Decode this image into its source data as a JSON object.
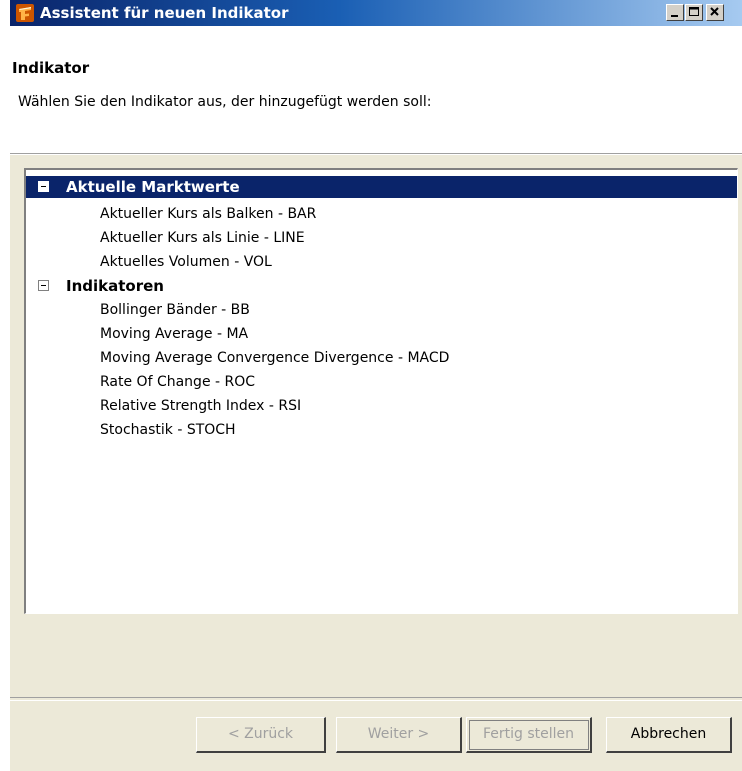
{
  "window": {
    "title": "Assistent für neuen Indikator"
  },
  "header": {
    "title": "Indikator",
    "description": "Wählen Sie den Indikator aus, der hinzugefügt werden soll:"
  },
  "tree": {
    "groups": [
      {
        "label": "Aktuelle Marktwerte",
        "selected": true,
        "items": [
          "Aktueller Kurs als Balken - BAR",
          "Aktueller Kurs als Linie - LINE",
          "Aktuelles Volumen - VOL"
        ]
      },
      {
        "label": "Indikatoren",
        "selected": false,
        "items": [
          "Bollinger Bänder - BB",
          "Moving Average - MA",
          "Moving Average Convergence Divergence - MACD",
          "Rate Of Change - ROC",
          "Relative Strength Index - RSI",
          "Stochastik - STOCH"
        ]
      }
    ]
  },
  "buttons": {
    "back": "< Zurück",
    "next": "Weiter >",
    "finish": "Fertig stellen",
    "cancel": "Abbrechen"
  },
  "colors": {
    "selection": "#0a246a",
    "title_gradient_start": "#0a246a",
    "title_gradient_end": "#a6caf0",
    "disabled_text": "#a0a0a0",
    "icon_accent": "#ff7a00"
  }
}
